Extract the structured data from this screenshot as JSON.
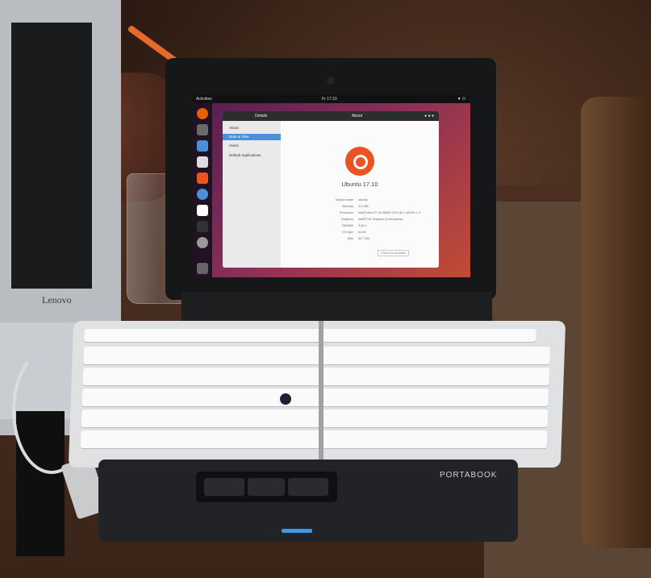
{
  "topbar": {
    "activities": "Activities",
    "clock": "Fr 17:10"
  },
  "window": {
    "title": "Details",
    "about_title": "About",
    "sidebar": [
      "About",
      "Date & Time",
      "Users",
      "Default Applications"
    ],
    "os_version": "Ubuntu 17.10",
    "details": [
      {
        "k": "Device name",
        "v": "ubuntu"
      },
      {
        "k": "Memory",
        "v": "3.6 GiB"
      },
      {
        "k": "Processor",
        "v": "Intel® Atom™ x5-Z8350 CPU @ 1.44GHz × 4"
      },
      {
        "k": "Graphics",
        "v": "Intel® HD Graphics (Cherryview)"
      },
      {
        "k": "GNOME",
        "v": "3.26.1"
      },
      {
        "k": "OS type",
        "v": "64-bit"
      },
      {
        "k": "Disk",
        "v": "30.7 GB"
      }
    ],
    "check_updates": "Check for updates"
  },
  "branding": {
    "keyboard": "PORTABOOK",
    "other_laptop": "Lenovo"
  },
  "accent": {
    "ubuntu_orange": "#e95420",
    "selection_blue": "#4a90d9",
    "led_blue": "#3a9ae8"
  }
}
